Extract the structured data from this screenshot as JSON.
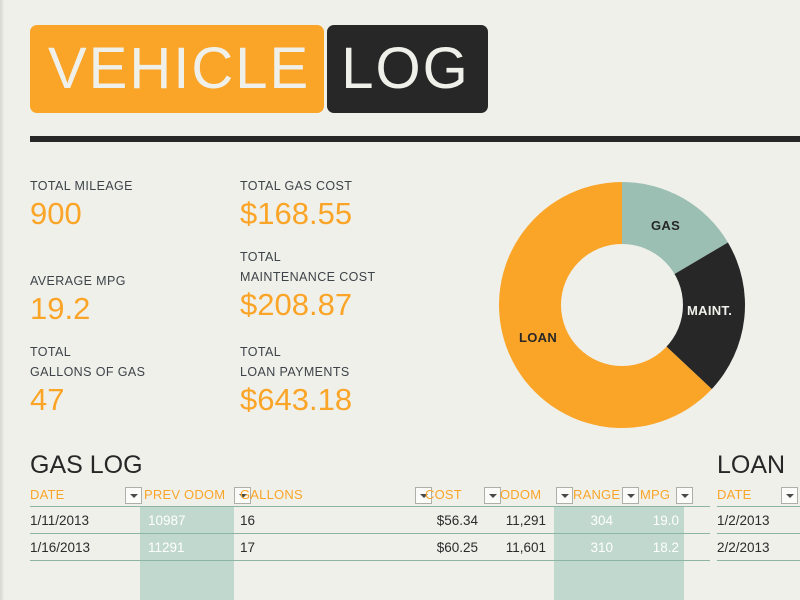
{
  "title": {
    "part1": "VEHICLE",
    "part2": "LOG"
  },
  "colors": {
    "orange": "#FAA528",
    "dark": "#272727",
    "background": "#F0F0EB",
    "band": "#C0D8CE",
    "donut_green": "#9CBFB3",
    "label_slate": "#3D4348"
  },
  "stats": [
    {
      "label": "TOTAL MILEAGE",
      "value": "900"
    },
    {
      "label": "AVERAGE MPG",
      "value": "19.2"
    },
    {
      "label_line1": "TOTAL",
      "label_line2": "GALLONS OF GAS",
      "value": "47"
    },
    {
      "label": "TOTAL GAS COST",
      "value": "$168.55"
    },
    {
      "label_line1": "TOTAL",
      "label_line2": "MAINTENANCE COST",
      "value": "$208.87"
    },
    {
      "label_line1": "TOTAL",
      "label_line2": "LOAN PAYMENTS",
      "value": "$643.18"
    }
  ],
  "chart_data": {
    "type": "pie",
    "title": "",
    "variant": "donut",
    "legend": "inside-slices",
    "categories": [
      "GAS",
      "MAINT.",
      "LOAN"
    ],
    "values": [
      168.55,
      208.87,
      643.18
    ],
    "percentages": [
      16.5,
      20.5,
      63.0
    ],
    "colors": [
      "#9CBFB3",
      "#272727",
      "#FAA528"
    ],
    "total": 1020.6,
    "start_angle_deg": 0,
    "inner_radius_ratio": 0.5
  },
  "gas_log": {
    "title": "GAS LOG",
    "columns": [
      "DATE",
      "PREV ODOM",
      "GALLONS",
      "COST",
      "ODOM",
      "RANGE",
      "MPG"
    ],
    "rows": [
      {
        "date": "1/11/2013",
        "prev_odom": "10987",
        "gallons": "16",
        "cost": "$56.34",
        "odom": "11,291",
        "range": "304",
        "mpg": "19.0"
      },
      {
        "date": "1/16/2013",
        "prev_odom": "11291",
        "gallons": "17",
        "cost": "$60.25",
        "odom": "11,601",
        "range": "310",
        "mpg": "18.2"
      }
    ]
  },
  "loan_log": {
    "title": "LOAN",
    "columns": [
      "DATE"
    ],
    "rows": [
      {
        "date": "1/2/2013"
      },
      {
        "date": "2/2/2013"
      }
    ]
  }
}
